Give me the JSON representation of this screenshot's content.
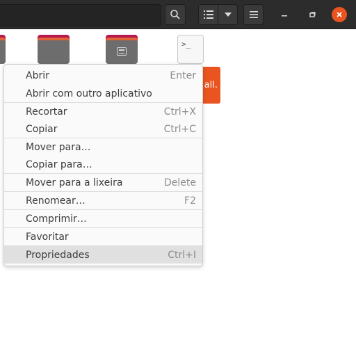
{
  "header": {
    "search_icon": "search-icon",
    "view_icon": "list-view-icon",
    "view_dropdown_icon": "chevron-down-icon",
    "menu_icon": "hamburger-menu-icon",
    "close_color": "#e95420"
  },
  "files": {
    "terminal_glyph": ">_",
    "install_label": "all."
  },
  "context_menu": {
    "items": [
      {
        "label": "Abrir",
        "accel": "Enter"
      },
      {
        "label": "Abrir com outro aplicativo",
        "accel": ""
      },
      {
        "label": "Recortar",
        "accel": "Ctrl+X"
      },
      {
        "label": "Copiar",
        "accel": "Ctrl+C"
      },
      {
        "label": "Mover para…",
        "accel": ""
      },
      {
        "label": "Copiar para…",
        "accel": ""
      },
      {
        "label": "Mover para a lixeira",
        "accel": "Delete"
      },
      {
        "label": "Renomear…",
        "accel": "F2"
      },
      {
        "label": "Comprimir…",
        "accel": ""
      },
      {
        "label": "Favoritar",
        "accel": ""
      },
      {
        "label": "Propriedades",
        "accel": "Ctrl+I"
      }
    ]
  }
}
